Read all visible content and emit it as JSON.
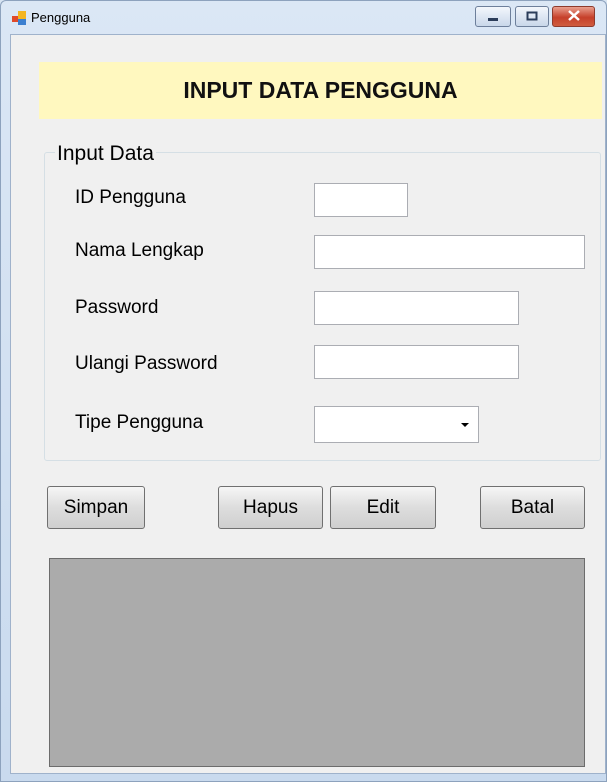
{
  "window": {
    "title": "Pengguna",
    "icons": {
      "app": "app-form-icon",
      "minimize": "minimize-icon",
      "maximize": "maximize-icon",
      "close": "close-icon"
    }
  },
  "form": {
    "header": "INPUT DATA PENGGUNA",
    "group_title": "Input Data",
    "fields": [
      {
        "label": "ID Pengguna",
        "value": ""
      },
      {
        "label": "Nama Lengkap",
        "value": ""
      },
      {
        "label": "Password",
        "value": ""
      },
      {
        "label": "Ulangi Password",
        "value": ""
      },
      {
        "label": "Tipe Pengguna",
        "value": ""
      }
    ]
  },
  "buttons": {
    "save": "Simpan",
    "delete": "Hapus",
    "edit": "Edit",
    "cancel": "Batal"
  },
  "colors": {
    "header_bg": "#fff8bf",
    "grid_bg": "#ababab",
    "close_btn": "#c6402a"
  }
}
